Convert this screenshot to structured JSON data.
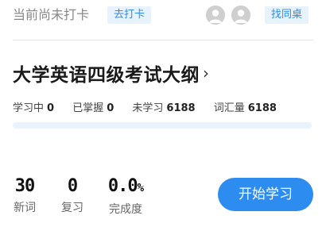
{
  "checkin": {
    "status": "当前尚未打卡",
    "button_label": "去打卡"
  },
  "deskmate": {
    "button_label": "找同桌"
  },
  "book": {
    "title": "大学英语四级考试大纲",
    "chevron": "›"
  },
  "stats": [
    {
      "label": "学习中",
      "value": "0"
    },
    {
      "label": "已掌握",
      "value": "0"
    },
    {
      "label": "未学习",
      "value": "6188"
    },
    {
      "label": "词汇量",
      "value": "6188"
    }
  ],
  "progress": {
    "fraction": 0,
    "color": "#2d8cf0",
    "track_color": "#eaf3fc"
  },
  "summary": {
    "new_words": {
      "value": "30",
      "label": "新词"
    },
    "review": {
      "value": "0",
      "label": "复习"
    },
    "completion": {
      "value": "0.0",
      "unit": "%",
      "label": "完成度"
    }
  },
  "start_button": {
    "label": "开始学习"
  },
  "colors": {
    "accent": "#2d8cf0",
    "accent_light": "#e6f2fd"
  },
  "icons": {
    "avatar": "user-avatar-icon",
    "chevron": "chevron-right-icon"
  }
}
